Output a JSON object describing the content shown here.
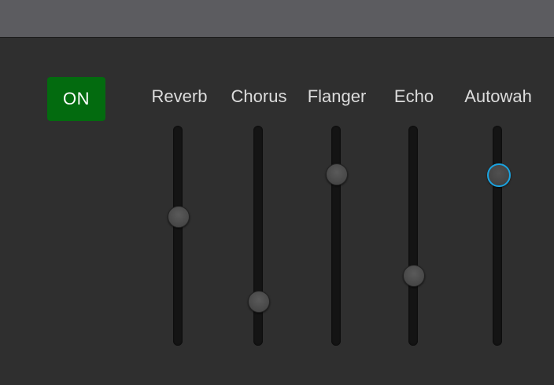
{
  "toggle": {
    "label": "ON",
    "state": "on",
    "color": "#036b0f"
  },
  "sliders": [
    {
      "label": "Reverb",
      "level": 0.59,
      "focused": false
    },
    {
      "label": "Chorus",
      "level": 0.19,
      "focused": false
    },
    {
      "label": "Flanger",
      "level": 0.79,
      "focused": false
    },
    {
      "label": "Echo",
      "level": 0.31,
      "focused": false
    },
    {
      "label": "Autowah",
      "level": 0.79,
      "focused": true
    }
  ],
  "colors": {
    "focus_ring": "#1aa3e0",
    "label_text": "#dcdcdc"
  }
}
